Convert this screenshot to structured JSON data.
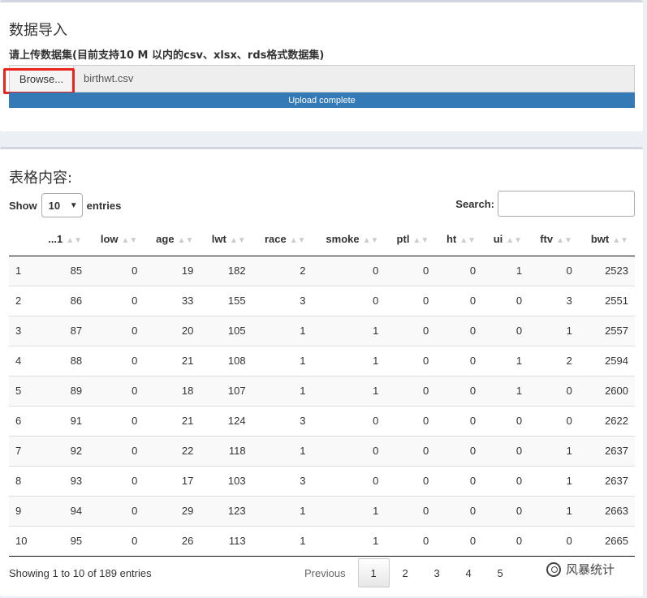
{
  "import_box": {
    "title": "数据导入",
    "upload_label": "请上传数据集(目前支持10 M 以内的csv、xlsx、rds格式数据集)",
    "browse_label": "Browse...",
    "file_name": "birthwt.csv",
    "progress_text": "Upload complete",
    "progress": 1.0
  },
  "table_box": {
    "title": "表格内容:",
    "show_label": "Show",
    "entries_value": "10",
    "entries_label": "entries",
    "search_label": "Search:",
    "search_value": "",
    "columns": [
      "",
      "...1",
      "low",
      "age",
      "lwt",
      "race",
      "smoke",
      "ptl",
      "ht",
      "ui",
      "ftv",
      "bwt"
    ],
    "rows": [
      [
        "1",
        "85",
        "0",
        "19",
        "182",
        "2",
        "0",
        "0",
        "0",
        "1",
        "0",
        "2523"
      ],
      [
        "2",
        "86",
        "0",
        "33",
        "155",
        "3",
        "0",
        "0",
        "0",
        "0",
        "3",
        "2551"
      ],
      [
        "3",
        "87",
        "0",
        "20",
        "105",
        "1",
        "1",
        "0",
        "0",
        "0",
        "1",
        "2557"
      ],
      [
        "4",
        "88",
        "0",
        "21",
        "108",
        "1",
        "1",
        "0",
        "0",
        "1",
        "2",
        "2594"
      ],
      [
        "5",
        "89",
        "0",
        "18",
        "107",
        "1",
        "1",
        "0",
        "0",
        "1",
        "0",
        "2600"
      ],
      [
        "6",
        "91",
        "0",
        "21",
        "124",
        "3",
        "0",
        "0",
        "0",
        "0",
        "0",
        "2622"
      ],
      [
        "7",
        "92",
        "0",
        "22",
        "118",
        "1",
        "0",
        "0",
        "0",
        "0",
        "1",
        "2637"
      ],
      [
        "8",
        "93",
        "0",
        "17",
        "103",
        "3",
        "0",
        "0",
        "0",
        "0",
        "1",
        "2637"
      ],
      [
        "9",
        "94",
        "0",
        "29",
        "123",
        "1",
        "1",
        "0",
        "0",
        "0",
        "1",
        "2663"
      ],
      [
        "10",
        "95",
        "0",
        "26",
        "113",
        "1",
        "1",
        "0",
        "0",
        "0",
        "0",
        "2665"
      ]
    ],
    "info_text": "Showing 1 to 10 of 189 entries",
    "pagination": {
      "previous": "Previous",
      "pages": [
        "1",
        "2",
        "3",
        "4",
        "5"
      ],
      "current": "1"
    }
  },
  "watermark": {
    "text": "风暴统计",
    "icon": "wechat-logo-icon"
  },
  "colors": {
    "accent": "#337ab7",
    "highlight": "#e8241c"
  }
}
